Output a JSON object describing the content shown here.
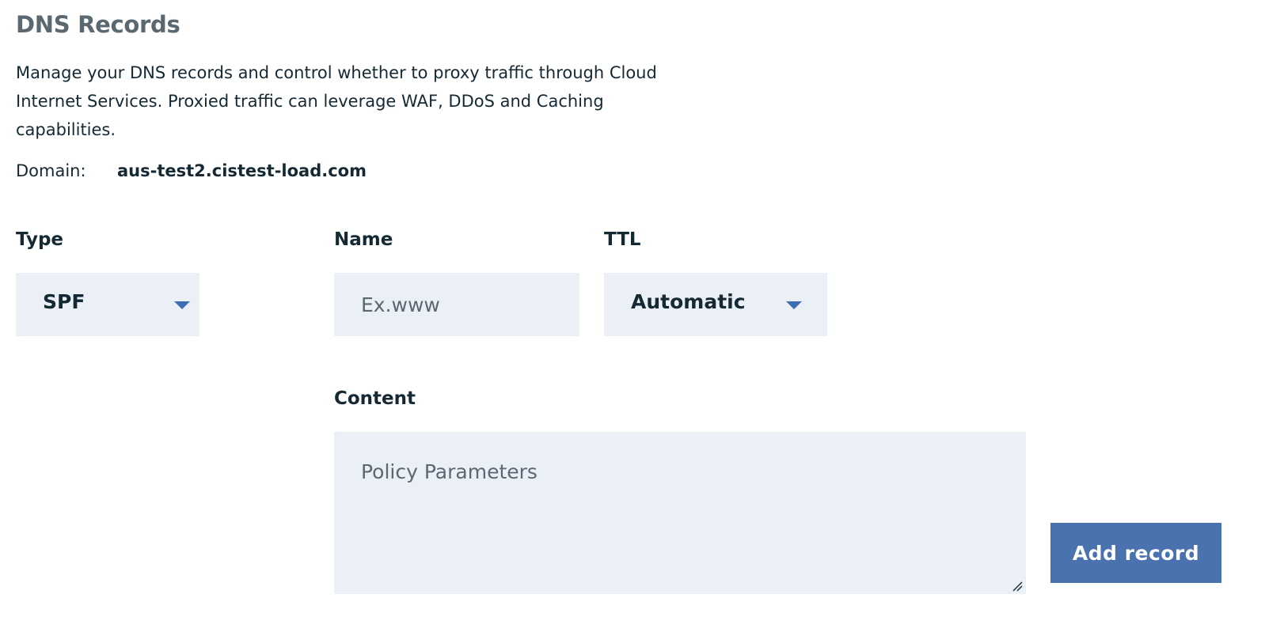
{
  "header": {
    "title": "DNS Records",
    "description": "Manage your DNS records and control whether to proxy traffic through Cloud Internet Services. Proxied traffic can leverage WAF, DDoS and Caching capabilities."
  },
  "domain": {
    "label": "Domain:",
    "value": "aus-test2.cistest-load.com"
  },
  "form": {
    "type": {
      "label": "Type",
      "selected": "SPF"
    },
    "name": {
      "label": "Name",
      "value": "",
      "placeholder": "Ex.www"
    },
    "ttl": {
      "label": "TTL",
      "selected": "Automatic"
    },
    "content": {
      "label": "Content",
      "value": "",
      "placeholder": "Policy Parameters"
    },
    "submit_label": "Add record"
  },
  "icons": {
    "dropdown": "chevron-down-icon",
    "resize": "resize-grip-icon"
  },
  "colors": {
    "field_background": "#ebf0f7",
    "accent": "#3d70b2",
    "button": "#4a72ae",
    "title": "#5a6872",
    "text": "#152935"
  }
}
